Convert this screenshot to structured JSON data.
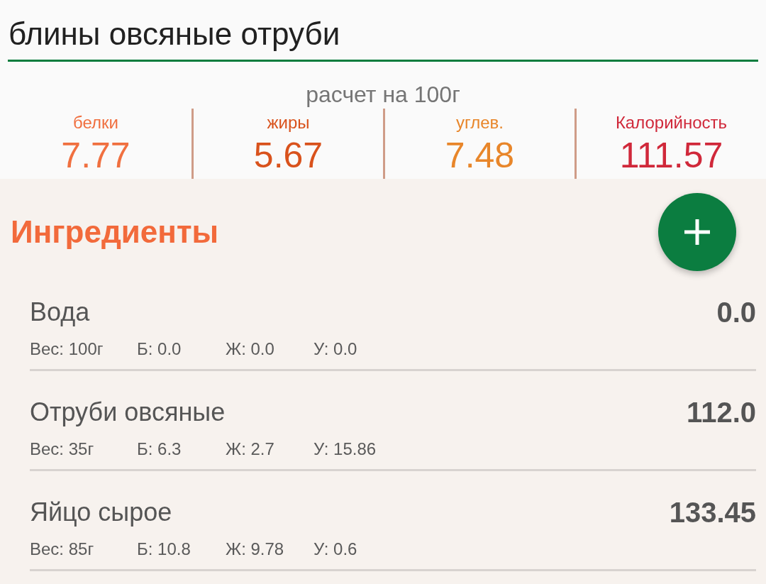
{
  "recipe": {
    "title": "блины овсяные отруби"
  },
  "summary": {
    "caption": "расчет на 100г",
    "nutrients": [
      {
        "label": "белки",
        "value": "7.77",
        "color": "#f07040"
      },
      {
        "label": "жиры",
        "value": "5.67",
        "color": "#d9521c"
      },
      {
        "label": "углев.",
        "value": "7.48",
        "color": "#e8862a"
      },
      {
        "label": "Калорийность",
        "value": "111.57",
        "color": "#d0283a"
      }
    ]
  },
  "ingredients": {
    "heading": "Ингредиенты",
    "items": [
      {
        "name": "Вода",
        "calories": "0.0",
        "weight": "Вес: 100г",
        "protein": "Б: 0.0",
        "fat": "Ж: 0.0",
        "carbs": "У: 0.0"
      },
      {
        "name": "Отруби овсяные",
        "calories": "112.0",
        "weight": "Вес: 35г",
        "protein": "Б: 6.3",
        "fat": "Ж: 2.7",
        "carbs": "У: 15.86"
      },
      {
        "name": "Яйцо сырое",
        "calories": "133.45",
        "weight": "Вес: 85г",
        "protein": "Б: 10.8",
        "fat": "Ж: 9.78",
        "carbs": "У: 0.6"
      }
    ]
  }
}
